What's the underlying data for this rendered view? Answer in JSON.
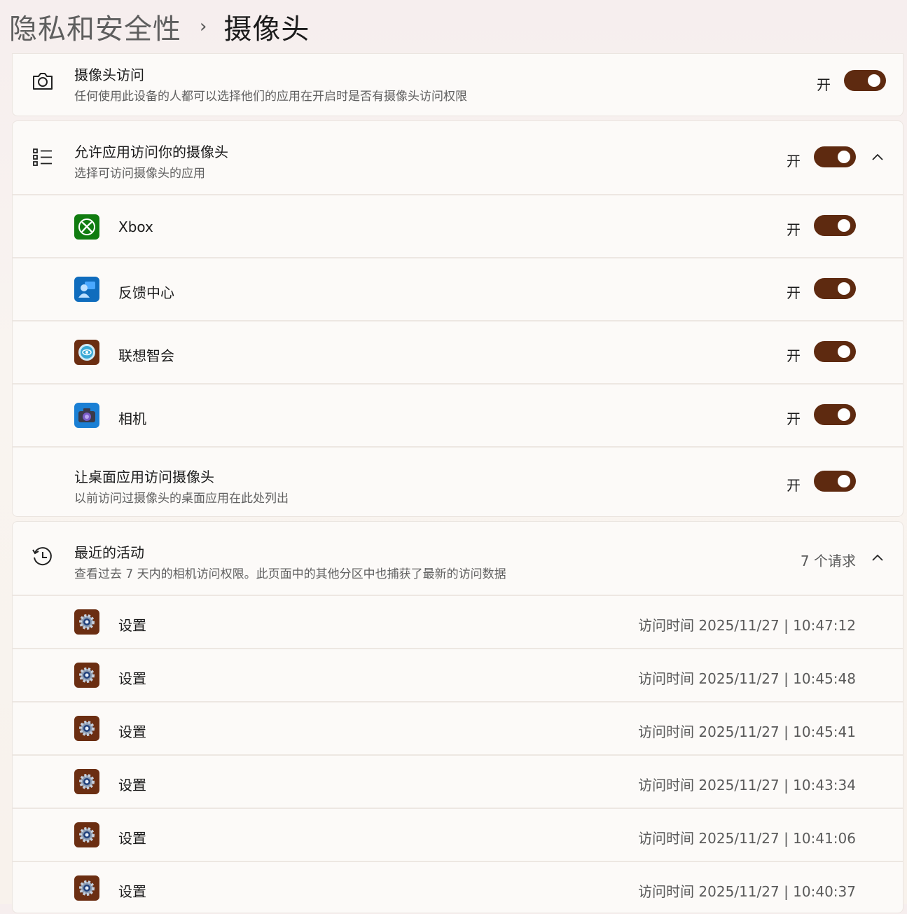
{
  "breadcrumb": {
    "parent": "隐私和安全性",
    "separator": "›",
    "current": "摄像头"
  },
  "camera_access": {
    "title": "摄像头访问",
    "subtitle": "任何使用此设备的人都可以选择他们的应用在开启时是否有摄像头访问权限",
    "state": "开"
  },
  "app_access": {
    "title": "允许应用访问你的摄像头",
    "subtitle": "选择可访问摄像头的应用",
    "state": "开",
    "apps": [
      {
        "name": "Xbox",
        "state": "开",
        "icon": "xbox-icon",
        "color": "#107c10"
      },
      {
        "name": "反馈中心",
        "state": "开",
        "icon": "feedback-hub-icon",
        "color": "#0f6cbd"
      },
      {
        "name": "联想智会",
        "state": "开",
        "icon": "lenovo-meeting-icon",
        "color": "#6b2e12"
      },
      {
        "name": "相机",
        "state": "开",
        "icon": "camera-app-icon",
        "color": "#1a7fd4"
      }
    ],
    "desktop": {
      "title": "让桌面应用访问摄像头",
      "subtitle": "以前访问过摄像头的桌面应用在此处列出",
      "state": "开"
    }
  },
  "recent": {
    "title": "最近的活动",
    "subtitle": "查看过去 7 天内的相机访问权限。此页面中的其他分区中也捕获了最新的访问数据",
    "count": "7 个请求",
    "items": [
      {
        "name": "设置",
        "time": "访问时间 2025/11/27 | 10:47:12"
      },
      {
        "name": "设置",
        "time": "访问时间 2025/11/27 | 10:45:48"
      },
      {
        "name": "设置",
        "time": "访问时间 2025/11/27 | 10:45:41"
      },
      {
        "name": "设置",
        "time": "访问时间 2025/11/27 | 10:43:34"
      },
      {
        "name": "设置",
        "time": "访问时间 2025/11/27 | 10:41:06"
      },
      {
        "name": "设置",
        "time": "访问时间 2025/11/27 | 10:40:37"
      }
    ]
  },
  "colors": {
    "accent": "#5e2a10",
    "settings_icon_bg": "#6b2e12"
  }
}
